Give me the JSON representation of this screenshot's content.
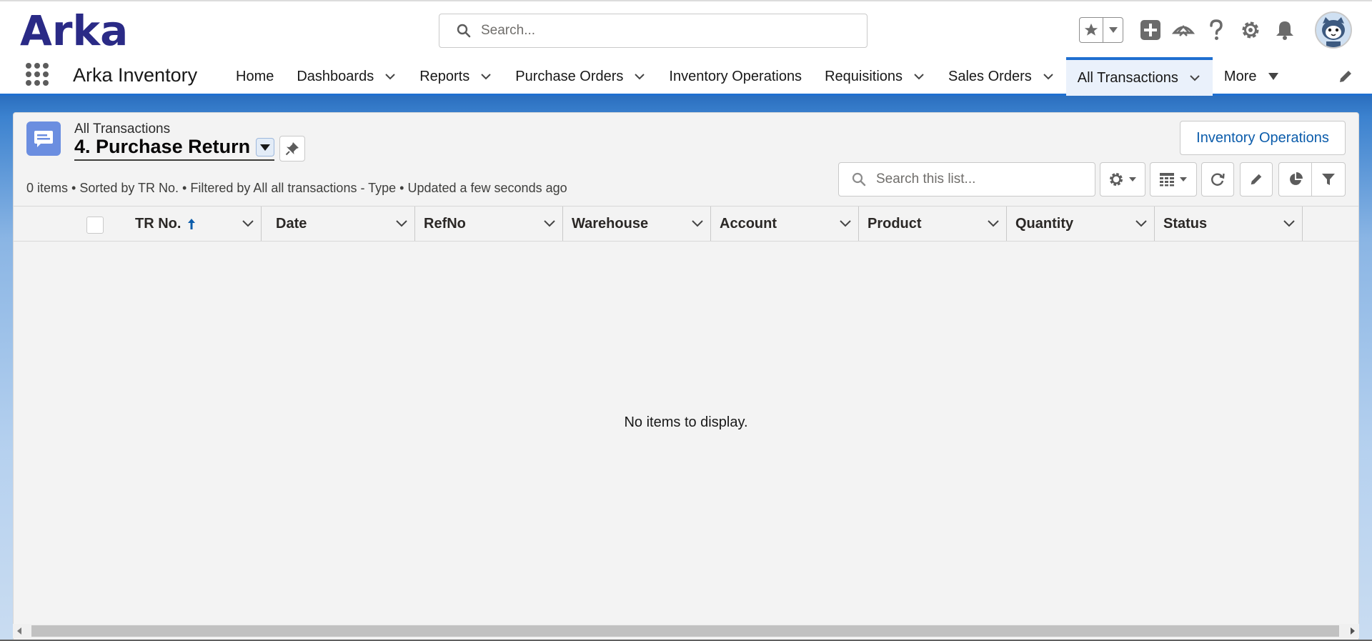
{
  "header": {
    "logo_text": "Arka",
    "search_placeholder": "Search...",
    "icons": [
      "star-icon",
      "caret-down-icon",
      "add-icon",
      "trailhead-icon",
      "help-icon",
      "setup-gear-icon",
      "bell-icon",
      "avatar"
    ]
  },
  "nav": {
    "app_name": "Arka Inventory",
    "items": [
      {
        "label": "Home",
        "has_menu": false,
        "active": false
      },
      {
        "label": "Dashboards",
        "has_menu": true,
        "active": false
      },
      {
        "label": "Reports",
        "has_menu": true,
        "active": false
      },
      {
        "label": "Purchase Orders",
        "has_menu": true,
        "active": false
      },
      {
        "label": "Inventory Operations",
        "has_menu": false,
        "active": false
      },
      {
        "label": "Requisitions",
        "has_menu": true,
        "active": false
      },
      {
        "label": "Sales Orders",
        "has_menu": true,
        "active": false
      },
      {
        "label": "All Transactions",
        "has_menu": true,
        "active": true
      },
      {
        "label": "More",
        "has_menu": true,
        "active": false
      }
    ]
  },
  "list_view": {
    "object_label": "All Transactions",
    "title": "4. Purchase Return",
    "action_button": "Inventory Operations",
    "meta": "0 items • Sorted by TR No. • Filtered by All all transactions - Type • Updated a few seconds ago",
    "search_placeholder": "Search this list...",
    "columns": [
      "TR No.",
      "Date",
      "RefNo",
      "Warehouse",
      "Account",
      "Product",
      "Quantity",
      "Status"
    ],
    "sorted_column": "TR No.",
    "empty_message": "No items to display."
  },
  "colors": {
    "brand": "#2a2a86",
    "accent": "#1f6fd0",
    "link": "#0b5cab",
    "object_icon": "#6b8ee0"
  }
}
